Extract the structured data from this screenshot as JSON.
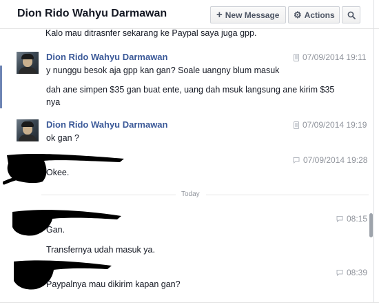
{
  "header": {
    "title": "Dion Rido Wahyu Darmawan",
    "new_message": "New Message",
    "actions": "Actions"
  },
  "icons": {
    "plus": "plus-icon",
    "gear": "gear-icon",
    "search": "search-icon",
    "desktop": "desktop-icon",
    "chat": "chat-bubble-icon"
  },
  "thread": {
    "cut_text": "Kalo mau ditrasnfer sekarang ke Paypal saya juga gpp.",
    "groups": [
      {
        "sender": "Dion Rido Wahyu Darmawan",
        "time": "07/09/2014 19:11",
        "messages": [
          "y nunggu besok aja gpp kan gan? Soale uangny blum masuk",
          "dah ane simpen $35 gan buat ente, uang dah msuk langsung ane kirim $35 nya"
        ]
      },
      {
        "sender": "Dion Rido Wahyu Darmawan",
        "time": "07/09/2014 19:19",
        "messages": [
          "ok gan ?"
        ]
      },
      {
        "time": "07/09/2014 19:28",
        "messages": [
          "Okee."
        ]
      }
    ],
    "divider_label": "Today",
    "today_groups": [
      {
        "time": "08:15",
        "messages": [
          "Gan.",
          "Transfernya udah masuk ya."
        ]
      },
      {
        "time": "08:39",
        "messages": [
          "Paypalnya mau dikirim kapan gan?"
        ]
      }
    ]
  }
}
